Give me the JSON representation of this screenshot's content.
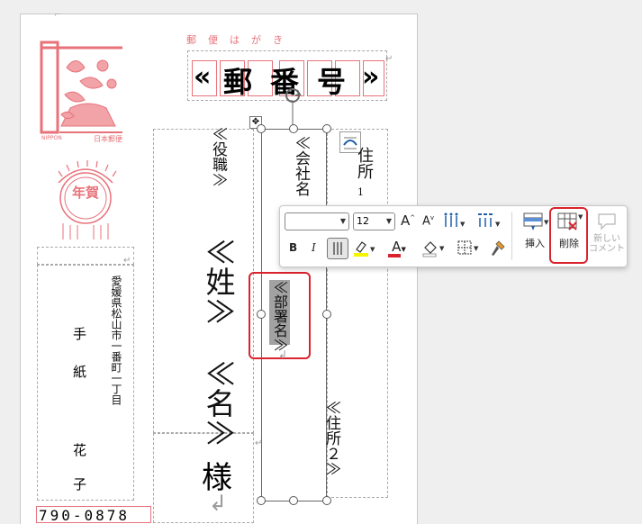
{
  "stamp": {
    "nippon": "NIPPON",
    "japan_post": "日本郵便",
    "nenga": "年賀"
  },
  "header": {
    "postcard_label": "郵　便　は　が　き"
  },
  "recipient_zip": {
    "open": "«",
    "field": "郵",
    "field2": "番",
    "field3": "号",
    "close": "»"
  },
  "fields": {
    "title": "≪役職≫",
    "company": "≪会社名",
    "address": "住所",
    "address_num": "1",
    "department": "≪部署名≫",
    "surname": "≪姓≫",
    "given": "≪名≫",
    "honorific": "様",
    "address2": "≪住所２≫"
  },
  "sender": {
    "address": "愛媛県松山市一番町一丁目",
    "name1": "手",
    "name2": "紙",
    "name3": "花",
    "name4": "子",
    "zip": "790-0878"
  },
  "toolbar": {
    "font_name": "",
    "font_size": "12",
    "grow_font": "A",
    "shrink_font": "A",
    "bold": "B",
    "italic": "I",
    "font_color": "A",
    "insert_label": "挿入",
    "delete_label": "削除",
    "new_comment_label": "新しい\nコメント",
    "highlight_color": "#f5f500",
    "font_color_value": "#d9232d"
  },
  "colors": {
    "accent_red": "#d9232d",
    "stamp_pink": "#e8727a"
  }
}
